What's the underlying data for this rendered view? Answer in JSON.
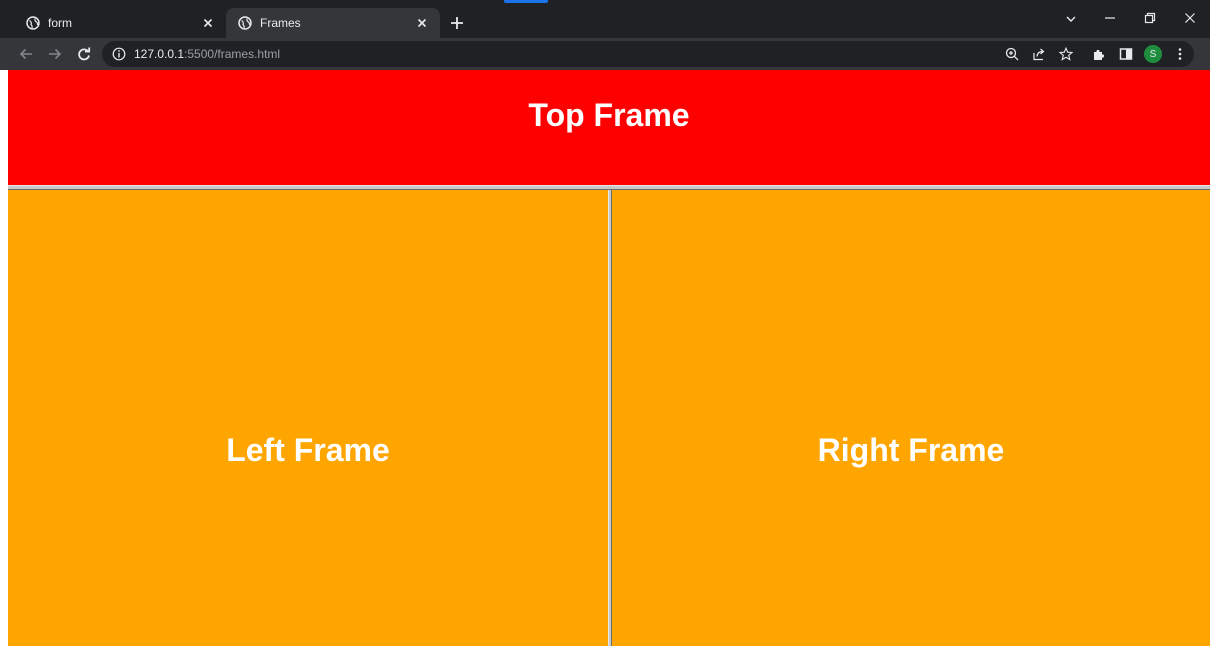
{
  "browser": {
    "tabs": [
      {
        "title": "form",
        "active": false,
        "icon": "globe-icon"
      },
      {
        "title": "Frames",
        "active": true,
        "icon": "globe-icon"
      }
    ],
    "address": {
      "host": "127.0.0.1",
      "path": ":5500/frames.html"
    },
    "profile_initial": "S",
    "colors": {
      "tabstrip": "#202124",
      "toolbar": "#35363a",
      "avatar": "#1e8e3e"
    }
  },
  "frames": {
    "top": {
      "heading": "Top Frame",
      "color": "#ff0000"
    },
    "left": {
      "heading": "Left Frame",
      "color": "#ffa500"
    },
    "right": {
      "heading": "Right Frame",
      "color": "#ffa500"
    }
  }
}
